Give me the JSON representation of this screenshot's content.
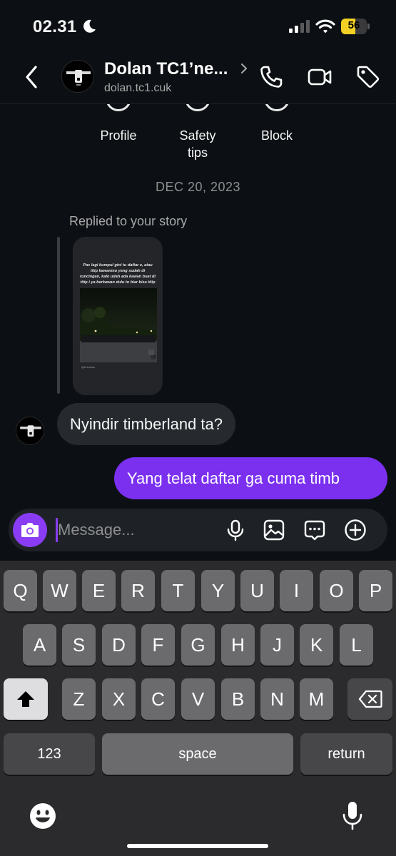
{
  "status": {
    "time": "02.31",
    "battery": "56",
    "battery_level": 0.56
  },
  "header": {
    "name": "Dolan TC1’ne...",
    "handle": "dolan.tc1.cuk",
    "avatar_text": "DOLAN TC1"
  },
  "profile_actions": [
    {
      "label": "Profile"
    },
    {
      "label": "Safety\ntips"
    },
    {
      "label": "Block"
    }
  ],
  "conversation": {
    "date": "DEC 20, 2023",
    "replied_label": "Replied to your story",
    "story_caption": "Pas lagi kumpul gini tu daftar e, atau titip kawanmu yang sudah di runcingan, kalo udah ada kawan buat di titip i ya berkawan dulu to biar bisa titip",
    "story_watermark": "@tc1dolan",
    "incoming": "Nyindir timberland ta?",
    "outgoing": "Yang telat daftar ga cuma timb"
  },
  "composer": {
    "placeholder": "Message...",
    "value": ""
  },
  "keyboard": {
    "row1": [
      "Q",
      "W",
      "E",
      "R",
      "T",
      "Y",
      "U",
      "I",
      "O",
      "P"
    ],
    "row2": [
      "A",
      "S",
      "D",
      "F",
      "G",
      "H",
      "J",
      "K",
      "L"
    ],
    "row3": [
      "Z",
      "X",
      "C",
      "V",
      "B",
      "N",
      "M"
    ],
    "numbers": "123",
    "space": "space",
    "return": "return"
  },
  "colors": {
    "accent": "#7b30f0",
    "background": "#0c1014",
    "incoming_bubble": "#262a2f"
  }
}
